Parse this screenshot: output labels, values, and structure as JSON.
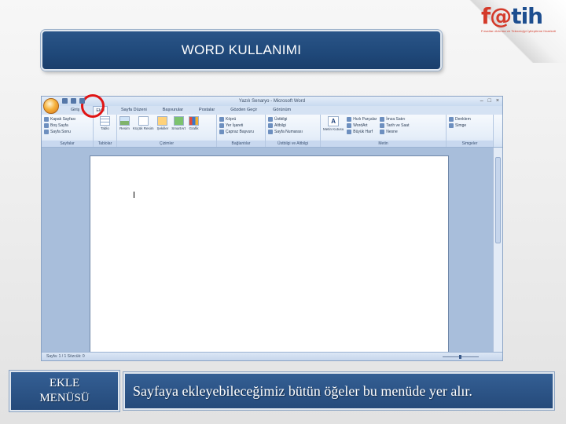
{
  "logo": {
    "text_main": "f@",
    "text_rest": "tih",
    "subtitle": "Fırsatları Artırma ve Teknolojiyi İyileştirme Hareketi"
  },
  "title": "WORD KULLANIMI",
  "word": {
    "window_title": "Yazılı Senaryo - Microsoft Word",
    "tabs": [
      "Giriş",
      "Ekle",
      "Sayfa Düzeni",
      "Başvurular",
      "Postalar",
      "Gözden Geçir",
      "Görünüm"
    ],
    "active_tab": "Ekle",
    "ribbon": {
      "pages": {
        "items": [
          "Kapak Sayfası",
          "Boş Sayfa",
          "Sayfa Sonu"
        ],
        "name": "Sayfalar"
      },
      "tables": {
        "item": "Tablo",
        "name": "Tablolar"
      },
      "illustrations": {
        "items": [
          "Resim",
          "Küçük Resim",
          "Şekiller",
          "SmartArt",
          "Grafik"
        ],
        "name": "Çizimler"
      },
      "links": {
        "items": [
          "Köprü",
          "Yer İşareti",
          "Çapraz Başvuru"
        ],
        "name": "Bağlantılar"
      },
      "header_footer": {
        "items": [
          "Üstbilgi",
          "Altbilgi",
          "Sayfa Numarası"
        ],
        "name": "Üstbilgi ve Altbilgi"
      },
      "text": {
        "big": "Metin Kutusu",
        "items": [
          "Hızlı Parçalar",
          "WordArt",
          "Büyük Harf"
        ],
        "items2": [
          "İmza Satırı",
          "Tarih ve Saat",
          "Nesne"
        ],
        "name": "Metin"
      },
      "symbols": {
        "items": [
          "Denklem",
          "Simge"
        ],
        "name": "Simgeler"
      }
    },
    "status_text": "Sayfa: 1 / 1     Sözcük: 0",
    "window_controls": [
      "–",
      "□",
      "×"
    ]
  },
  "menu_label": {
    "line1": "EKLE",
    "line2": "MENÜSÜ"
  },
  "description": "Sayfaya ekleyebileceğimiz bütün öğeler bu menüde yer alır."
}
